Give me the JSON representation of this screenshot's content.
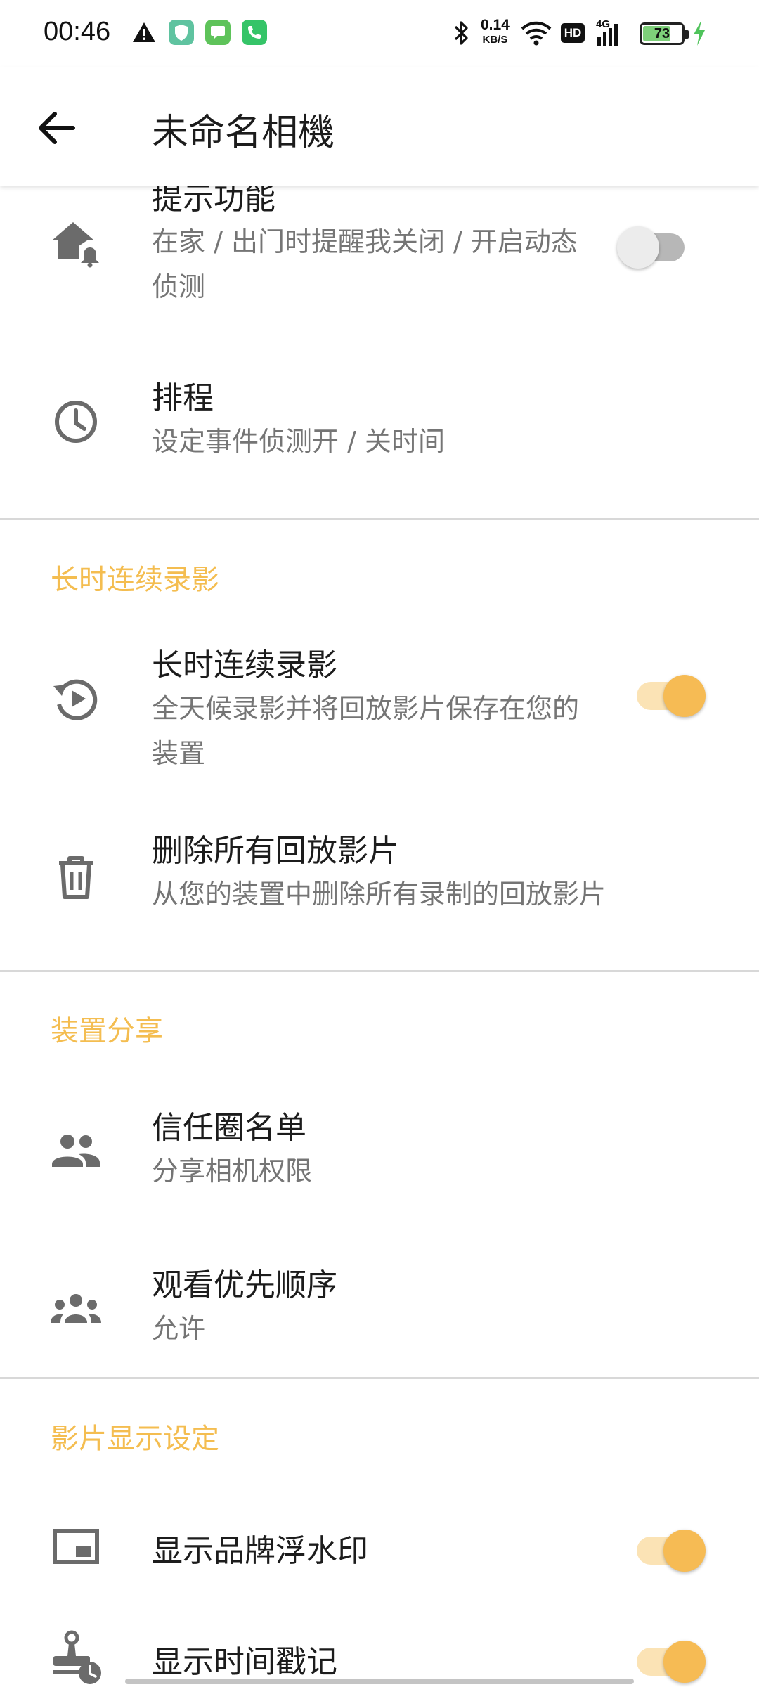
{
  "status_bar": {
    "time": "00:46",
    "net_speed_value": "0.14",
    "net_speed_unit": "KB/S",
    "battery": "73",
    "battery_level": 0.73,
    "network_badge": "HD",
    "network_type": "4G",
    "icons": [
      "warning-icon",
      "shield-app-icon",
      "message-app-icon",
      "phone-app-icon",
      "bluetooth-icon",
      "wifi-icon",
      "signal-icon",
      "charging-icon"
    ]
  },
  "app_bar": {
    "title": "未命名相機",
    "back_icon": "arrow-left-icon"
  },
  "rows": {
    "alert": {
      "title": "提示功能",
      "subtitle": "在家 / 出门时提醒我关闭 / 开启动态侦测",
      "icon": "home-bell-icon",
      "toggle": false
    },
    "schedule": {
      "title": "排程",
      "subtitle": "设定事件侦测开 / 关时间",
      "icon": "clock-icon"
    },
    "continuous": {
      "title": "长时连续录影",
      "subtitle": "全天候录影并将回放影片保存在您的装置",
      "icon": "replay-icon",
      "toggle": true
    },
    "delete_all": {
      "title": "删除所有回放影片",
      "subtitle": "从您的装置中删除所有录制的回放影片",
      "icon": "trash-icon"
    },
    "trusted": {
      "title": "信任圈名单",
      "subtitle": "分享相机权限",
      "icon": "people-icon"
    },
    "priority": {
      "title": "观看优先顺序",
      "subtitle": "允许",
      "icon": "groups-icon"
    },
    "watermark": {
      "title": "显示品牌浮水印",
      "icon": "picture-in-picture-icon",
      "toggle": true
    },
    "timestamp": {
      "title": "显示时间戳记",
      "icon": "stamp-clock-icon",
      "toggle": true
    }
  },
  "sections": {
    "continuous": "长时连续录影",
    "sharing": "装置分享",
    "video_display": "影片显示设定"
  },
  "colors": {
    "accent": "#f4bd50",
    "switch_on_thumb": "#f6bb54",
    "switch_on_track": "#fbe3b5",
    "switch_off_thumb": "#ececec",
    "switch_off_track": "#b7b7b7",
    "secondary_text": "#757575",
    "divider": "#d8d8d8"
  }
}
